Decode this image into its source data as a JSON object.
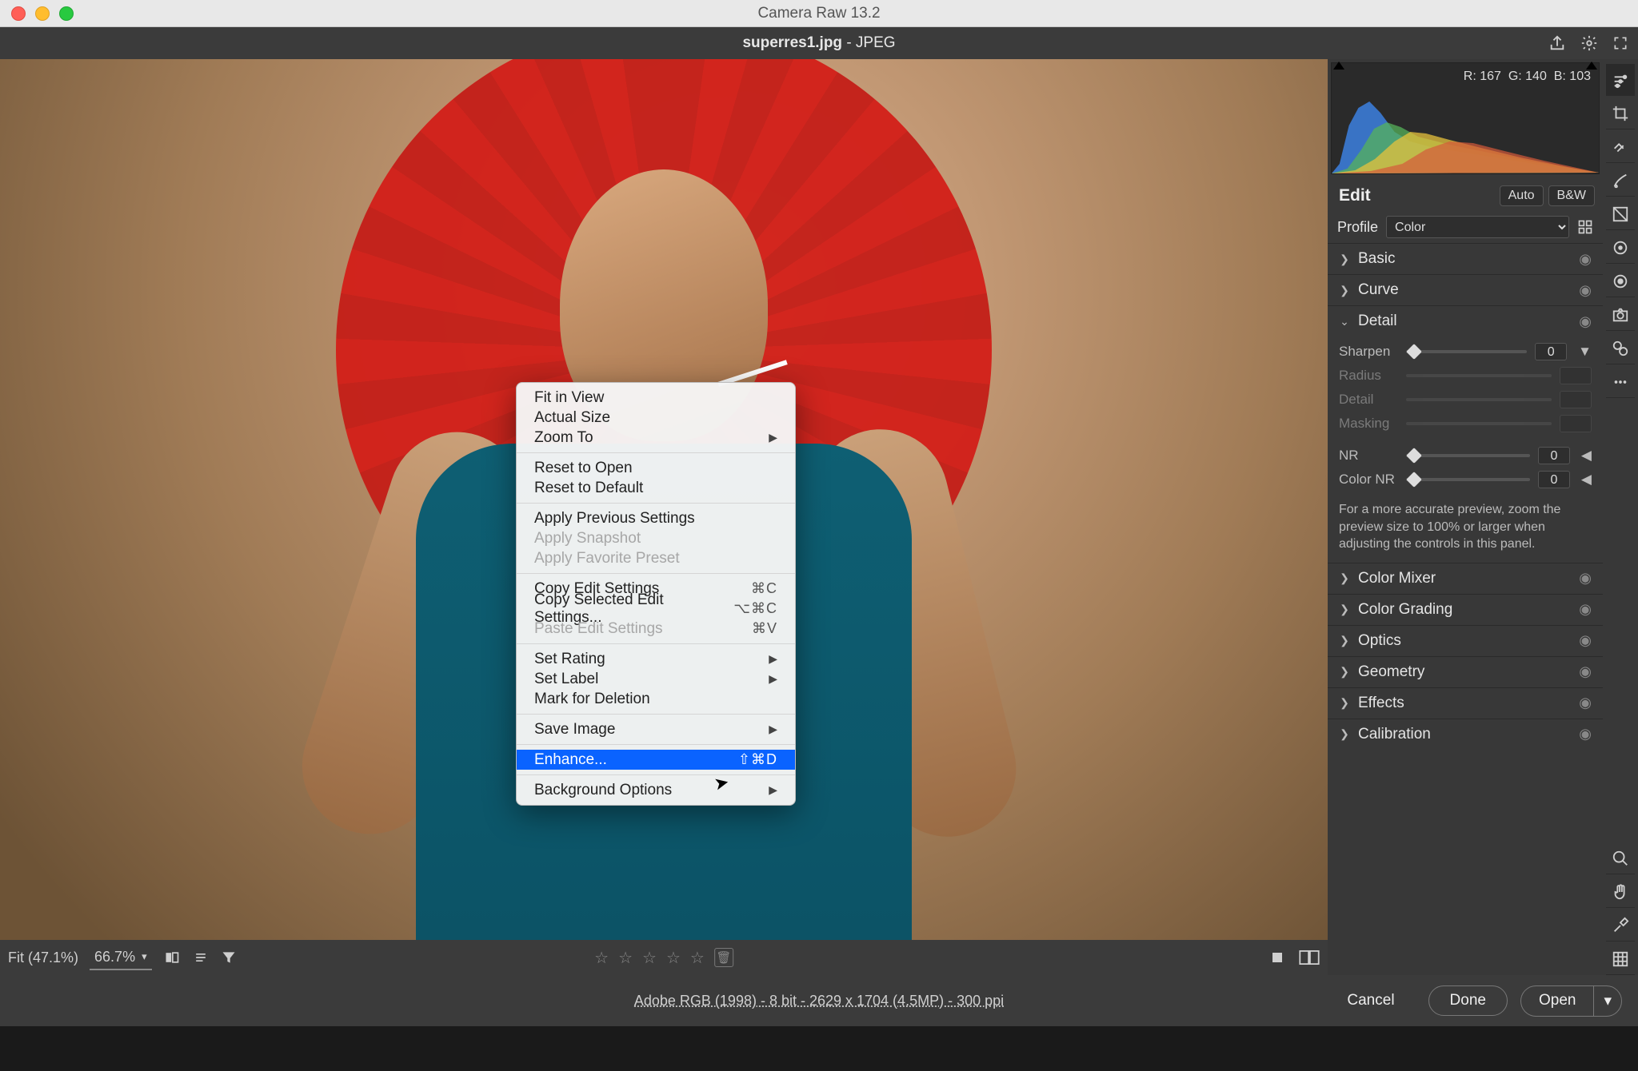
{
  "window_title": "Camera Raw 13.2",
  "document": {
    "filename": "superres1.jpg",
    "format_suffix": "  -  JPEG"
  },
  "histogram": {
    "r": "R: 167",
    "g": "G: 140",
    "b": "B: 103"
  },
  "edit": {
    "title": "Edit",
    "auto": "Auto",
    "bw": "B&W",
    "profile_label": "Profile",
    "profile_value": "Color"
  },
  "sections": {
    "basic": "Basic",
    "curve": "Curve",
    "detail": "Detail",
    "color_mixer": "Color Mixer",
    "color_grading": "Color Grading",
    "optics": "Optics",
    "geometry": "Geometry",
    "effects": "Effects",
    "calibration": "Calibration"
  },
  "detail": {
    "sharpen": {
      "label": "Sharpen",
      "value": "0"
    },
    "radius": {
      "label": "Radius"
    },
    "detail": {
      "label": "Detail"
    },
    "masking": {
      "label": "Masking"
    },
    "nr": {
      "label": "NR",
      "value": "0"
    },
    "colornr": {
      "label": "Color NR",
      "value": "0"
    },
    "hint": "For a more accurate preview, zoom the preview size to 100% or larger when adjusting the controls in this panel."
  },
  "context_menu": {
    "fit_in_view": "Fit in View",
    "actual_size": "Actual Size",
    "zoom_to": "Zoom To",
    "reset_to_open": "Reset to Open",
    "reset_to_default": "Reset to Default",
    "apply_previous": "Apply Previous Settings",
    "apply_snapshot": "Apply Snapshot",
    "apply_favorite": "Apply Favorite Preset",
    "copy_edit": "Copy Edit Settings",
    "copy_edit_sc": "⌘C",
    "copy_selected": "Copy Selected Edit Settings...",
    "copy_selected_sc": "⌥⌘C",
    "paste_edit": "Paste Edit Settings",
    "paste_edit_sc": "⌘V",
    "set_rating": "Set Rating",
    "set_label": "Set Label",
    "mark_delete": "Mark for Deletion",
    "save_image": "Save Image",
    "enhance": "Enhance...",
    "enhance_sc": "⇧⌘D",
    "bg_options": "Background Options"
  },
  "strip": {
    "fit": "Fit (47.1%)",
    "zoom": "66.7%"
  },
  "footer": {
    "meta": "Adobe RGB (1998) - 8 bit - 2629 x 1704 (4.5MP) - 300 ppi",
    "cancel": "Cancel",
    "done": "Done",
    "open": "Open"
  }
}
